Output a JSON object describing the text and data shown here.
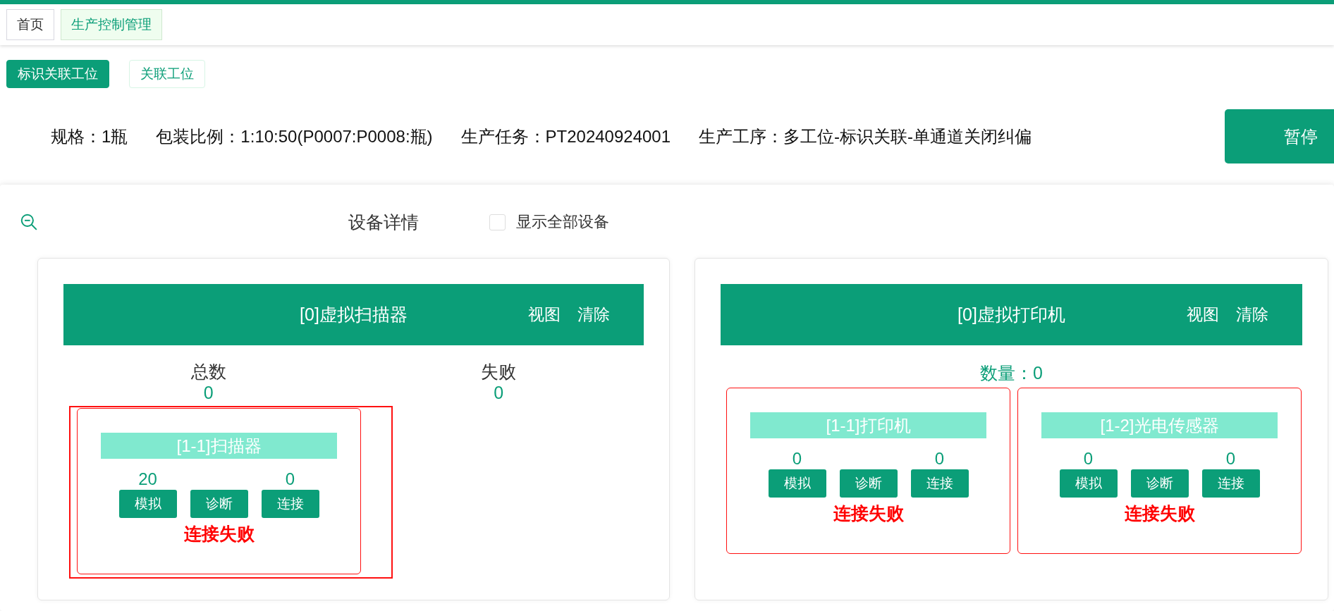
{
  "tabs": [
    {
      "label": "首页",
      "selected": false
    },
    {
      "label": "生产控制管理",
      "selected": true
    }
  ],
  "stations": [
    {
      "label": "标识关联工位",
      "selected": true
    },
    {
      "label": "关联工位",
      "selected": false
    }
  ],
  "info": [
    "规格：1瓶",
    "包装比例：1:10:50(P0007:P0008:瓶)",
    "生产任务：PT20240924001",
    "生产工序：多工位-标识关联-单通道关闭纠偏"
  ],
  "pause_button": "暂停",
  "panel": {
    "title": "设备详情",
    "show_all": {
      "label": "显示全部设备",
      "checked": false
    },
    "devices": [
      {
        "title": "[0]虚拟扫描器",
        "actions": [
          "视图",
          "清除"
        ],
        "kind": "stats",
        "stats": [
          {
            "label": "总数",
            "value": "0"
          },
          {
            "label": "失败",
            "value": "0"
          }
        ],
        "units": [
          {
            "name": "[1-1]扫描器",
            "values": [
              "20",
              "0"
            ],
            "buttons": [
              "模拟",
              "诊断",
              "连接"
            ],
            "status": "连接失败",
            "selected": true
          }
        ]
      },
      {
        "title": "[0]虚拟打印机",
        "actions": [
          "视图",
          "清除"
        ],
        "kind": "count",
        "count": "数量：0",
        "units": [
          {
            "name": "[1-1]打印机",
            "values": [
              "0",
              "0"
            ],
            "buttons": [
              "模拟",
              "诊断",
              "连接"
            ],
            "status": "连接失败",
            "selected": false
          },
          {
            "name": "[1-2]光电传感器",
            "values": [
              "0",
              "0"
            ],
            "buttons": [
              "模拟",
              "诊断",
              "连接"
            ],
            "status": "连接失败",
            "selected": false
          }
        ]
      }
    ]
  }
}
